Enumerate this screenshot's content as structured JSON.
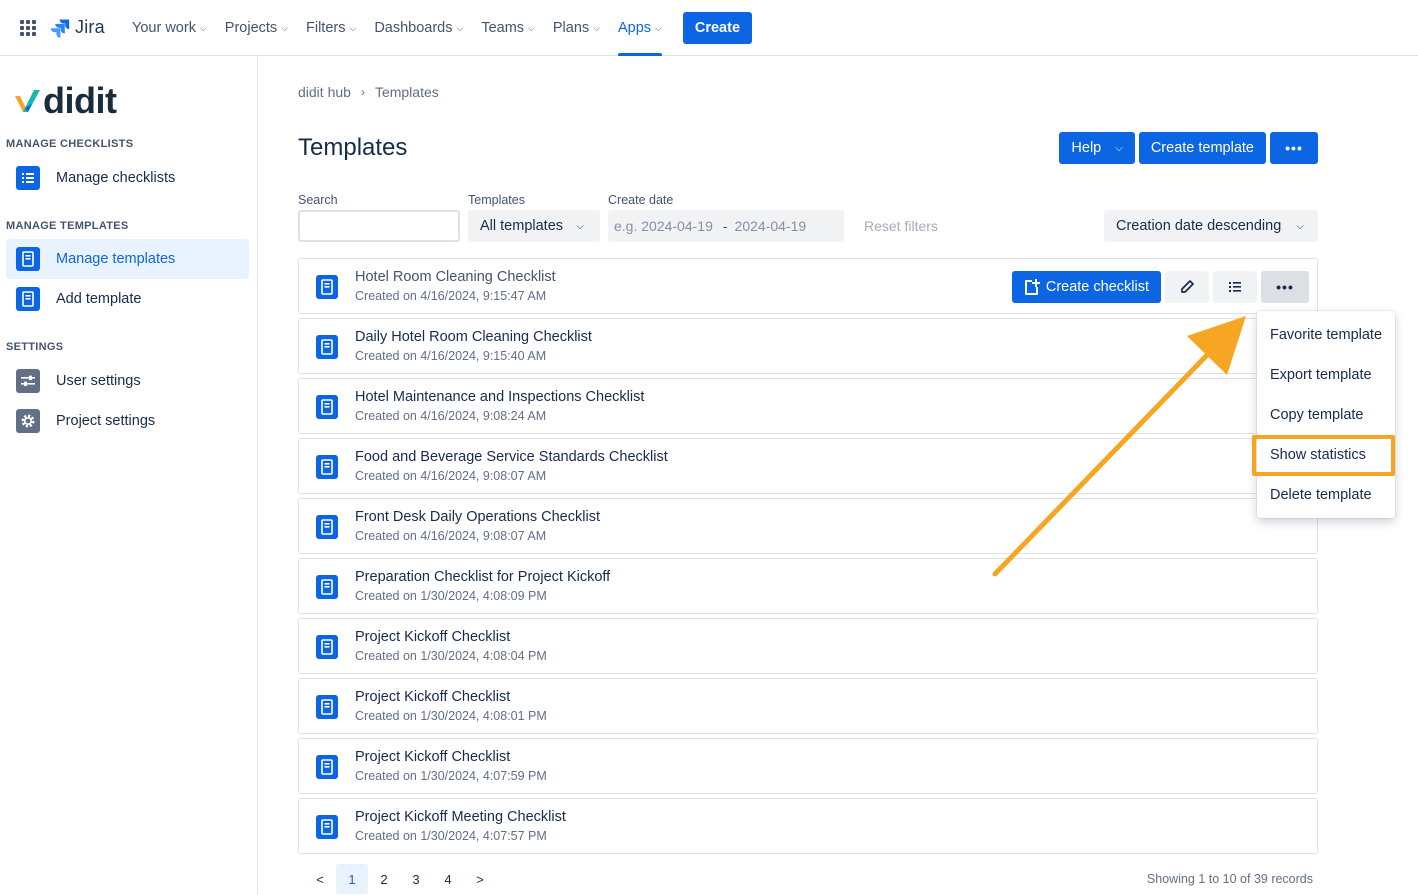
{
  "topnav": {
    "brand": "Jira",
    "items": [
      {
        "label": "Your work",
        "active": false
      },
      {
        "label": "Projects",
        "active": false
      },
      {
        "label": "Filters",
        "active": false
      },
      {
        "label": "Dashboards",
        "active": false
      },
      {
        "label": "Teams",
        "active": false
      },
      {
        "label": "Plans",
        "active": false
      },
      {
        "label": "Apps",
        "active": true
      }
    ],
    "create_label": "Create"
  },
  "sidebar": {
    "logo_text": "didit",
    "sections": [
      {
        "title": "MANAGE CHECKLISTS",
        "items": [
          {
            "label": "Manage checklists",
            "icon": "list-icon",
            "active": false
          }
        ]
      },
      {
        "title": "MANAGE TEMPLATES",
        "items": [
          {
            "label": "Manage templates",
            "icon": "template-icon",
            "active": true
          },
          {
            "label": "Add template",
            "icon": "template-icon",
            "active": false
          }
        ]
      },
      {
        "title": "SETTINGS",
        "items": [
          {
            "label": "User settings",
            "icon": "sliders-icon",
            "active": false
          },
          {
            "label": "Project settings",
            "icon": "gear-icon",
            "active": false
          }
        ]
      }
    ]
  },
  "breadcrumb": {
    "root": "didit hub",
    "current": "Templates"
  },
  "page": {
    "title": "Templates",
    "help_label": "Help",
    "create_template_label": "Create template",
    "more_label": "•••"
  },
  "filters": {
    "search_label": "Search",
    "search_value": "",
    "templates_label": "Templates",
    "templates_value": "All templates",
    "date_label": "Create date",
    "date_from_placeholder": "e.g. 2024-04-19",
    "date_to_placeholder": "2024-04-19",
    "reset_label": "Reset filters",
    "sort_value": "Creation date descending"
  },
  "rows": [
    {
      "title": "Hotel Room Cleaning Checklist",
      "created": "Created on 4/16/2024, 9:15:47 AM"
    },
    {
      "title": "Daily Hotel Room Cleaning Checklist",
      "created": "Created on 4/16/2024, 9:15:40 AM"
    },
    {
      "title": "Hotel Maintenance and Inspections Checklist",
      "created": "Created on 4/16/2024, 9:08:24 AM"
    },
    {
      "title": "Food and Beverage Service Standards Checklist",
      "created": "Created on 4/16/2024, 9:08:07 AM"
    },
    {
      "title": "Front Desk Daily Operations Checklist",
      "created": "Created on 4/16/2024, 9:08:07 AM"
    },
    {
      "title": "Preparation Checklist for Project Kickoff",
      "created": "Created on 1/30/2024, 4:08:09 PM"
    },
    {
      "title": "Project Kickoff Checklist",
      "created": "Created on 1/30/2024, 4:08:04 PM"
    },
    {
      "title": "Project Kickoff Checklist",
      "created": "Created on 1/30/2024, 4:08:01 PM"
    },
    {
      "title": "Project Kickoff Checklist",
      "created": "Created on 1/30/2024, 4:07:59 PM"
    },
    {
      "title": "Project Kickoff Meeting Checklist",
      "created": "Created on 1/30/2024, 4:07:57 PM"
    }
  ],
  "row_actions": {
    "create_checklist_label": "Create checklist"
  },
  "menu": {
    "items": [
      "Favorite template",
      "Export template",
      "Copy template",
      "Show statistics",
      "Delete template"
    ],
    "highlighted": "Show statistics"
  },
  "pagination": {
    "prev": "<",
    "next": ">",
    "pages": [
      "1",
      "2",
      "3",
      "4"
    ],
    "current": "1",
    "records_text": "Showing 1 to 10 of 39 records"
  },
  "colors": {
    "accent": "#0c66e4",
    "annotation": "#f6a623"
  }
}
